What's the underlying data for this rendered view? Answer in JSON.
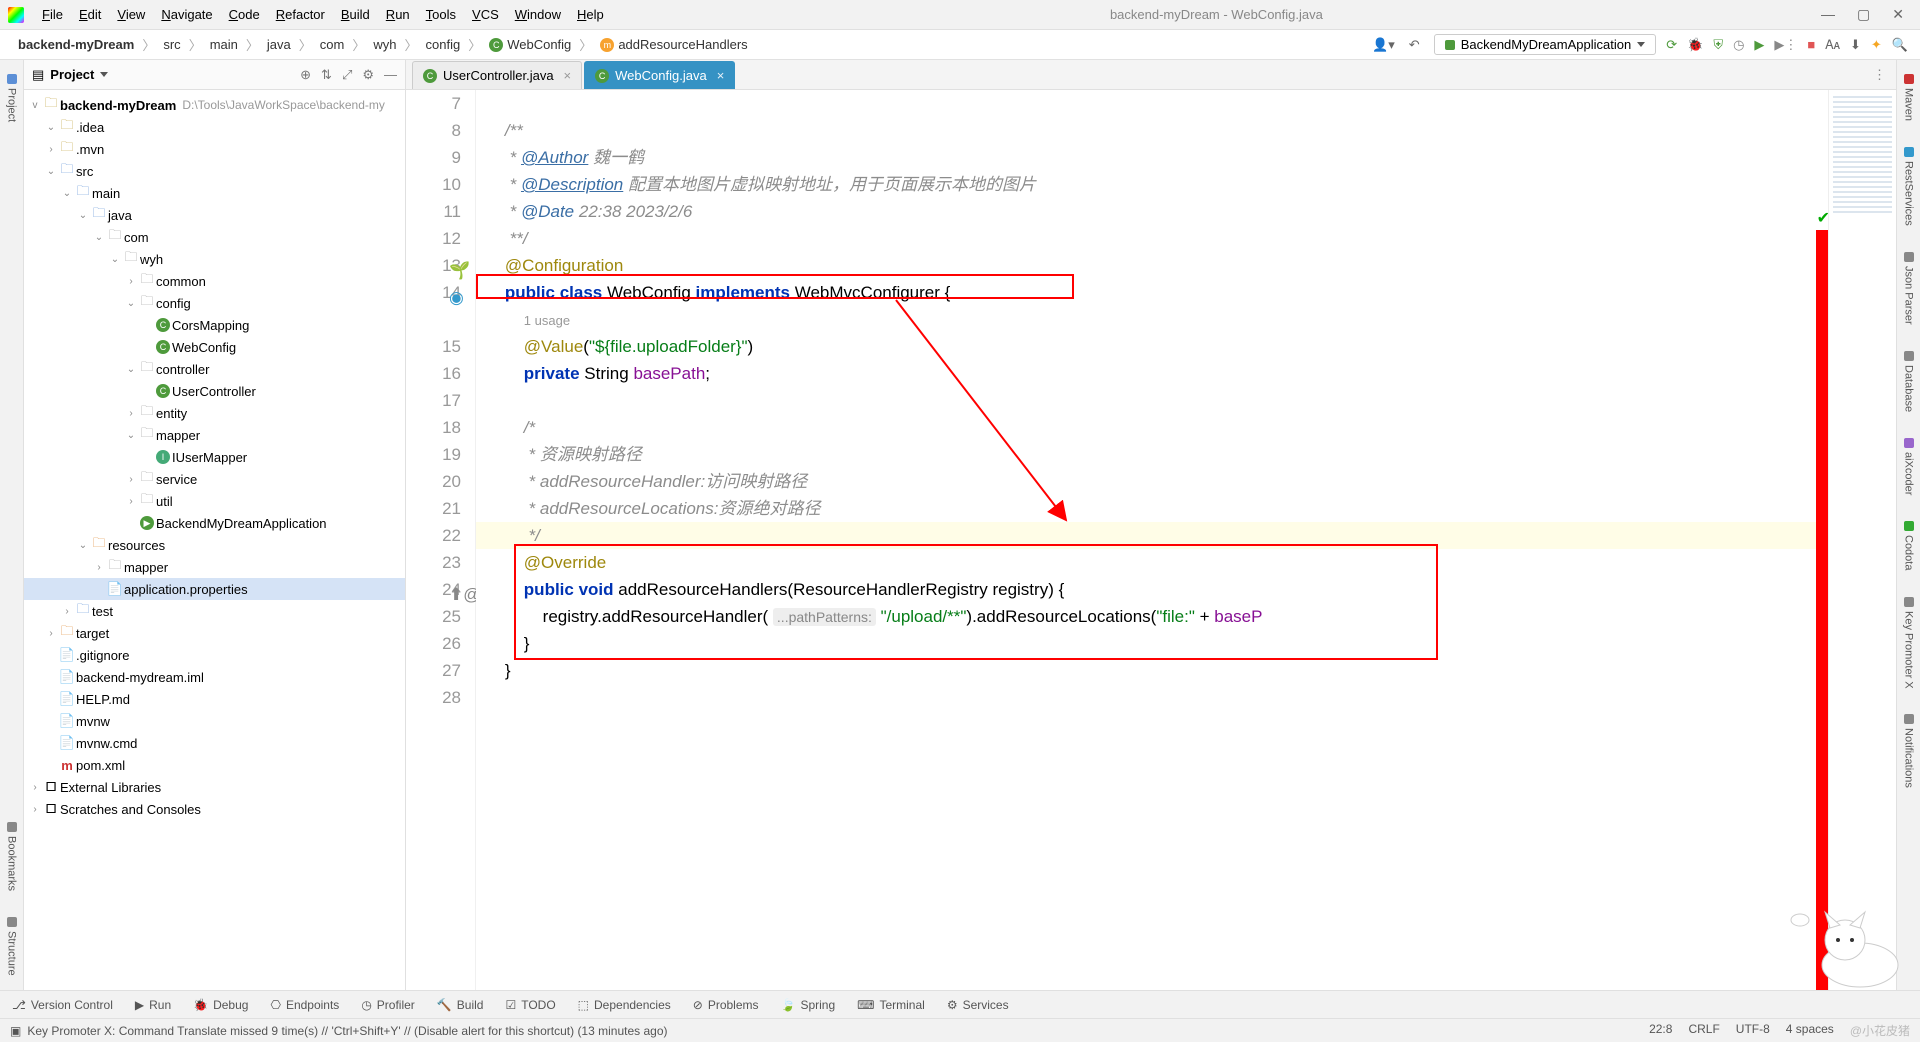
{
  "menubar": {
    "items": [
      "File",
      "Edit",
      "View",
      "Navigate",
      "Code",
      "Refactor",
      "Build",
      "Run",
      "Tools",
      "VCS",
      "Window",
      "Help"
    ],
    "title": "backend-myDream - WebConfig.java"
  },
  "breadcrumb": {
    "parts": [
      "backend-myDream",
      "src",
      "main",
      "java",
      "com",
      "wyh",
      "config",
      "WebConfig",
      "addResourceHandlers"
    ],
    "runConfig": "BackendMyDreamApplication"
  },
  "leftStrip": [
    "Project",
    "Bookmarks",
    "Structure"
  ],
  "rightStrip": [
    "Maven",
    "RestServices",
    "Json Parser",
    "Database",
    "aiXcoder",
    "Codota",
    "Key Promoter X",
    "Notifications"
  ],
  "projectPanel": {
    "title": "Project",
    "root": "backend-myDream",
    "rootHint": "D:\\Tools\\JavaWorkSpace\\backend-my",
    "tree": [
      {
        "d": 1,
        "a": "v",
        "i": "fld",
        "t": ".idea"
      },
      {
        "d": 1,
        "a": ">",
        "i": "fld",
        "t": ".mvn"
      },
      {
        "d": 1,
        "a": "v",
        "i": "fld blue",
        "t": "src"
      },
      {
        "d": 2,
        "a": "v",
        "i": "fld blue",
        "t": "main"
      },
      {
        "d": 3,
        "a": "v",
        "i": "fld blue",
        "t": "java"
      },
      {
        "d": 4,
        "a": "v",
        "i": "fld gray",
        "t": "com"
      },
      {
        "d": 5,
        "a": "v",
        "i": "fld gray",
        "t": "wyh"
      },
      {
        "d": 6,
        "a": ">",
        "i": "fld gray",
        "t": "common"
      },
      {
        "d": 6,
        "a": "v",
        "i": "fld gray",
        "t": "config"
      },
      {
        "d": 7,
        "a": " ",
        "i": "cls",
        "t": "CorsMapping"
      },
      {
        "d": 7,
        "a": " ",
        "i": "cls",
        "t": "WebConfig"
      },
      {
        "d": 6,
        "a": "v",
        "i": "fld gray",
        "t": "controller"
      },
      {
        "d": 7,
        "a": " ",
        "i": "cls",
        "t": "UserController"
      },
      {
        "d": 6,
        "a": ">",
        "i": "fld gray",
        "t": "entity"
      },
      {
        "d": 6,
        "a": "v",
        "i": "fld gray",
        "t": "mapper"
      },
      {
        "d": 7,
        "a": " ",
        "i": "ifc",
        "t": "IUserMapper"
      },
      {
        "d": 6,
        "a": ">",
        "i": "fld gray",
        "t": "service"
      },
      {
        "d": 6,
        "a": ">",
        "i": "fld gray",
        "t": "util"
      },
      {
        "d": 6,
        "a": " ",
        "i": "run",
        "t": "BackendMyDreamApplication"
      },
      {
        "d": 3,
        "a": "v",
        "i": "fld orange",
        "t": "resources"
      },
      {
        "d": 4,
        "a": ">",
        "i": "fld gray",
        "t": "mapper"
      },
      {
        "d": 4,
        "a": " ",
        "i": "prop",
        "t": "application.properties",
        "sel": true
      },
      {
        "d": 2,
        "a": ">",
        "i": "fld blue",
        "t": "test"
      },
      {
        "d": 1,
        "a": ">",
        "i": "fld orange",
        "t": "target"
      },
      {
        "d": 1,
        "a": " ",
        "i": "file",
        "t": ".gitignore"
      },
      {
        "d": 1,
        "a": " ",
        "i": "file",
        "t": "backend-mydream.iml"
      },
      {
        "d": 1,
        "a": " ",
        "i": "file",
        "t": "HELP.md"
      },
      {
        "d": 1,
        "a": " ",
        "i": "file",
        "t": "mvnw"
      },
      {
        "d": 1,
        "a": " ",
        "i": "file",
        "t": "mvnw.cmd"
      },
      {
        "d": 1,
        "a": " ",
        "i": "mvn",
        "t": "pom.xml"
      }
    ],
    "extLib": "External Libraries",
    "scratch": "Scratches and Consoles"
  },
  "tabs": {
    "items": [
      {
        "name": "UserController.java",
        "active": false
      },
      {
        "name": "WebConfig.java",
        "active": true
      }
    ]
  },
  "editor": {
    "startLine": 7,
    "lines": [
      {
        "n": 7,
        "html": ""
      },
      {
        "n": 8,
        "html": "    <span class='doc'>/**</span>"
      },
      {
        "n": 9,
        "html": "    <span class='doc'> * <span class='doctag'>@Author</span> 魏一鹤</span>"
      },
      {
        "n": 10,
        "html": "    <span class='doc'> * <span class='doctag'>@Description</span> 配置本地图片虚拟映射地址，用于页面展示本地的图片</span>"
      },
      {
        "n": 11,
        "html": "    <span class='doc'> * <span class='doctag nu'>@Date</span> 22:38 2023/2/6</span>"
      },
      {
        "n": 12,
        "html": "    <span class='doc'> **/</span>"
      },
      {
        "n": 13,
        "html": "    <span class='ann'>@Configuration</span>",
        "g": "bean"
      },
      {
        "n": 14,
        "html": "    <span class='kw'>public</span> <span class='kw'>class</span> <span class='type'>WebConfig</span> <span class='kw'>implements</span> <span class='type'>WebMvcConfigurer</span> {",
        "g": "impl"
      },
      {
        "n": 0,
        "html": "        <span class='usage'>1 usage</span>"
      },
      {
        "n": 15,
        "html": "        <span class='ann'>@Value</span>(<span class='str'>\"${file.uploadFolder}\"</span>)"
      },
      {
        "n": 16,
        "html": "        <span class='kw'>private</span> <span class='type'>String</span> <span class='id'>basePath</span>;"
      },
      {
        "n": 17,
        "html": ""
      },
      {
        "n": 18,
        "html": "        <span class='cmt'>/*</span>"
      },
      {
        "n": 19,
        "html": "        <span class='cmt'> * 资源映射路径</span>"
      },
      {
        "n": 20,
        "html": "        <span class='cmt'> * addResourceHandler:访问映射路径</span>"
      },
      {
        "n": 21,
        "html": "        <span class='cmt'> * addResourceLocations:资源绝对路径</span>"
      },
      {
        "n": 22,
        "html": "        <span class='cmt'> */</span>",
        "caret": true
      },
      {
        "n": 23,
        "html": "        <span class='ann'>@Override</span>"
      },
      {
        "n": 24,
        "html": "        <span class='kw'>public</span> <span class='kw'>void</span> addResourceHandlers(<span class='type'>ResourceHandlerRegistry</span> registry) {",
        "g": "ov"
      },
      {
        "n": 25,
        "html": "            registry.addResourceHandler( <span class='hint-inline'>...pathPatterns:</span> <span class='str'>\"/upload/**\"</span>).addResourceLocations(<span class='str'>\"file:\"</span> + <span class='id'>baseP</span>"
      },
      {
        "n": 26,
        "html": "        }"
      },
      {
        "n": 27,
        "html": "    }"
      },
      {
        "n": 28,
        "html": ""
      }
    ]
  },
  "toolwin": [
    "Version Control",
    "Run",
    "Debug",
    "Endpoints",
    "Profiler",
    "Build",
    "TODO",
    "Dependencies",
    "Problems",
    "Spring",
    "Terminal",
    "Services"
  ],
  "status": {
    "left": "Key Promoter X: Command Translate missed 9 time(s) // 'Ctrl+Shift+Y' // (Disable alert for this shortcut) (13 minutes ago)",
    "pos": "22:8",
    "lineSep": "CRLF",
    "enc": "UTF-8",
    "indent": "4 spaces",
    "watermark": "@小花皮猪"
  }
}
